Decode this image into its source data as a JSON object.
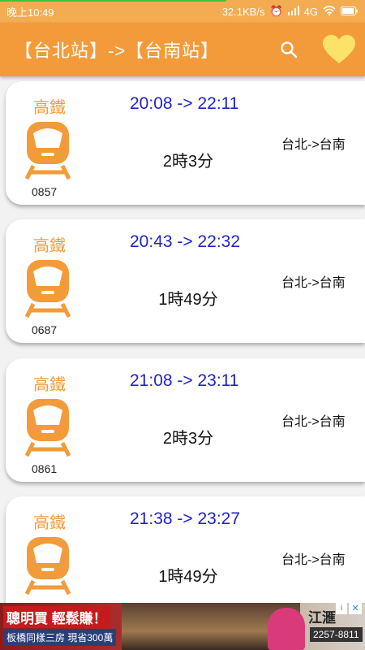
{
  "status_bar": {
    "time": "晚上10:49",
    "net_speed": "32.1KB/s",
    "network": "4G",
    "load_progress": 0.62
  },
  "app_bar": {
    "title": "【台北站】->【台南站】",
    "search_icon": "search-icon",
    "favorite_icon": "heart-icon"
  },
  "colors": {
    "accent": "#f39b3a",
    "status": "#f4ac52",
    "time_text": "#2222cc"
  },
  "trains": [
    {
      "operator": "高鐵",
      "number": "0857",
      "times": "20:08 -> 22:11",
      "duration": "2時3分",
      "route": "台北->台南"
    },
    {
      "operator": "高鐵",
      "number": "0687",
      "times": "20:43 -> 22:32",
      "duration": "1時49分",
      "route": "台北->台南"
    },
    {
      "operator": "高鐵",
      "number": "0861",
      "times": "21:08 -> 23:11",
      "duration": "2時3分",
      "route": "台北->台南"
    },
    {
      "operator": "高鐵",
      "number": "",
      "times": "21:38 -> 23:27",
      "duration": "1時49分",
      "route": "台北->台南"
    }
  ],
  "ad": {
    "headline": "聰明買 輕鬆賺！",
    "subline": "板橋同樣三房 現省300萬",
    "brand": "江滙",
    "phone": "2257-8811"
  }
}
